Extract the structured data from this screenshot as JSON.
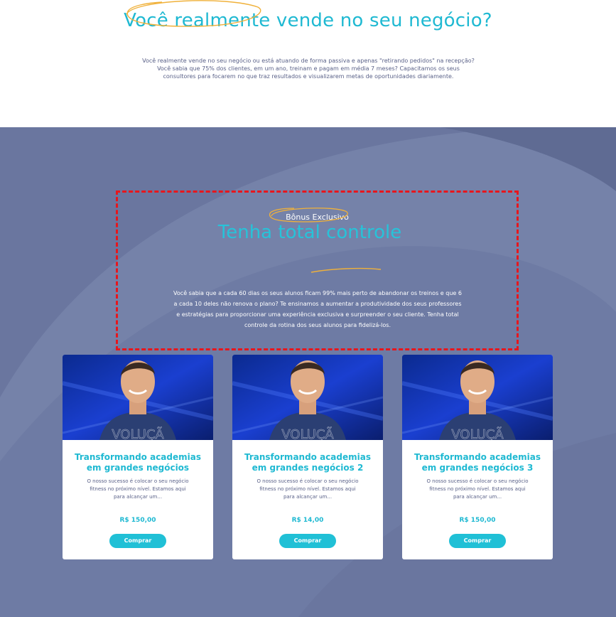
{
  "colors": {
    "accent": "#1fb9d2",
    "section_bg": "#6a769f",
    "highlight_stroke": "#f0b13a",
    "dashed_border": "#e8161c",
    "button_bg": "#20c0d6"
  },
  "hero": {
    "title": "Você realmente vende no seu negócio?",
    "text": "Você realmente vende no seu negócio ou está atuando de forma passiva e apenas \"retirando pedidos\" na recepção? Você sabia que 75% dos clientes, em um ano, treinam e pagam em média 7 meses? Capacitamos os seus consultores para focarem no que traz resultados e visualizarem metas de oportunidades diariamente."
  },
  "bonus": {
    "label": "Bônus Exclusivo",
    "title": "Tenha total controle",
    "text": "Você sabia que a cada 60 dias os seus alunos ficam 99% mais perto de abandonar os treinos e que 6 a cada 10 deles não renova o plano? Te ensinamos a aumentar a produtividade dos seus professores e estratégias para proporcionar uma experiência exclusiva e surpreender o seu cliente. Tenha total controle da rotina dos seus alunos para fidelizá-los."
  },
  "cards": [
    {
      "title": "Transformando academias em grandes negócios",
      "description": "O nosso sucesso é colocar o seu negócio fitness no próximo nível. Estamos aqui para alcançar um...",
      "price": "R$ 150,00",
      "button": "Comprar"
    },
    {
      "title": "Transformando academias em grandes negócios 2",
      "description": "O nosso sucesso é colocar o seu negócio fitness no próximo nível. Estamos aqui para alcançar um...",
      "price": "R$ 14,00",
      "button": "Comprar"
    },
    {
      "title": "Transformando academias em grandes negócios 3",
      "description": "O nosso sucesso é colocar o seu negócio fitness no próximo nível. Estamos aqui para alcançar um...",
      "price": "R$ 150,00",
      "button": "Comprar"
    }
  ]
}
